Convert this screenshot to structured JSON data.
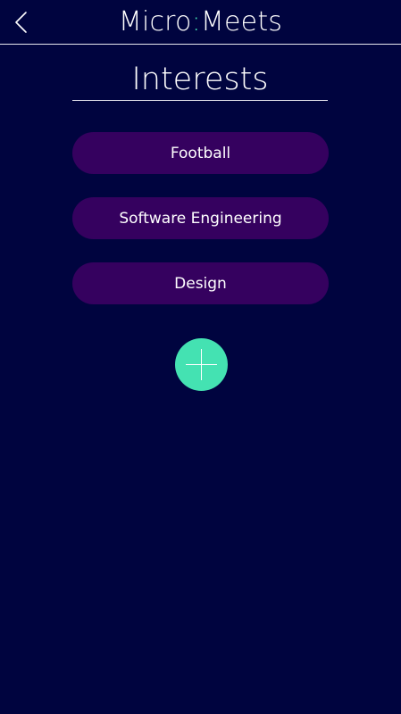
{
  "header": {
    "brand_left": "Micro",
    "brand_colon": ":",
    "brand_right": "Meets"
  },
  "page_title": "Interests",
  "interests": [
    {
      "label": "Football"
    },
    {
      "label": "Software Engineering"
    },
    {
      "label": "Design"
    }
  ],
  "icons": {
    "back": "chevron-left-icon",
    "add": "plus-icon"
  },
  "colors": {
    "background": "#00043f",
    "pill": "#35015f",
    "accent": "#44e2b2",
    "text": "#ffffff"
  }
}
